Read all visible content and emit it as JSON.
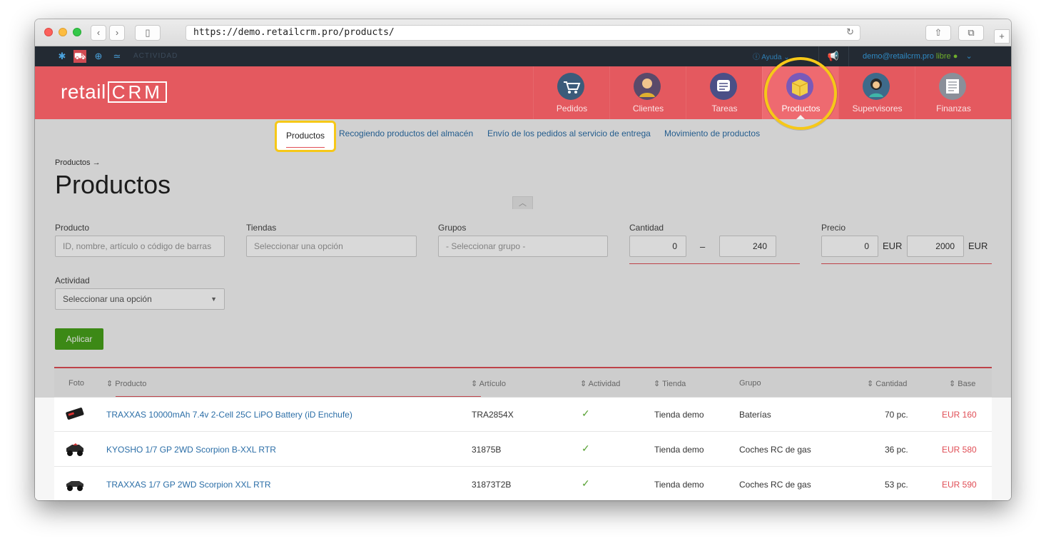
{
  "browser": {
    "url": "https://demo.retailcrm.pro/products/",
    "back_glyph": "‹",
    "forward_glyph": "›",
    "reload_glyph": "↻",
    "sidebar_glyph": "▯",
    "share_glyph": "⇧",
    "tabs_glyph": "⧉",
    "newtab_glyph": "+"
  },
  "topbar": {
    "actividad_label": "ACTIVIDAD",
    "help_label": "Ayuda",
    "user_email": "demo@retailcrm.pro",
    "user_status": "libre",
    "status_dot": "●",
    "chevron": "⌄"
  },
  "header": {
    "logo_text": "retail",
    "logo_crm": "CRM",
    "nav": [
      {
        "label": "Pedidos",
        "icon": "cart-icon",
        "color": "#3b5b7a"
      },
      {
        "label": "Clientes",
        "icon": "person-icon",
        "color": "#5a4a6a"
      },
      {
        "label": "Tareas",
        "icon": "list-icon",
        "color": "#4b4f86"
      },
      {
        "label": "Productos",
        "icon": "box-icon",
        "color": "#7a5ab8"
      },
      {
        "label": "Supervisores",
        "icon": "supervisor-icon",
        "color": "#3e6a8a"
      },
      {
        "label": "Finanzas",
        "icon": "ledger-icon",
        "color": "#8a8f99"
      }
    ]
  },
  "subnav": {
    "active": "Productos",
    "items": [
      "Recogiendo productos del almacén",
      "Envío de los pedidos al servicio de entrega",
      "Movimiento de productos"
    ]
  },
  "page": {
    "breadcrumb": "Productos →",
    "title": "Productos",
    "collapse_glyph": "︿"
  },
  "filters": {
    "producto": {
      "label": "Producto",
      "placeholder": "ID, nombre, artículo o código de barras"
    },
    "tiendas": {
      "label": "Tiendas",
      "placeholder": "Seleccionar una opción"
    },
    "grupos": {
      "label": "Grupos",
      "placeholder": "- Seleccionar grupo -"
    },
    "cantidad": {
      "label": "Cantidad",
      "min": "0",
      "max": "240",
      "dash": "–"
    },
    "precio": {
      "label": "Precio",
      "min": "0",
      "max": "2000",
      "currency": "EUR"
    },
    "actividad": {
      "label": "Actividad",
      "placeholder": "Seleccionar una opción",
      "caret": "▼"
    },
    "apply_label": "Aplicar"
  },
  "table": {
    "headers": {
      "foto": "Foto",
      "producto": "Producto",
      "articulo": "Artículo",
      "actividad": "Actividad",
      "tienda": "Tienda",
      "grupo": "Grupo",
      "cantidad": "Cantidad",
      "base": "Base"
    },
    "sort_glyph": "⇕",
    "check_glyph": "✓",
    "rows": [
      {
        "producto": "TRAXXAS 10000mAh 7.4v 2-Cell 25C LiPO Battery (iD Enchufe)",
        "articulo": "TRA2854X",
        "tienda": "Tienda demo",
        "grupo": "Baterías",
        "cantidad": "70 pc.",
        "base": "EUR 160"
      },
      {
        "producto": "KYOSHO 1/7 GP 2WD Scorpion B-XXL RTR",
        "articulo": "31875B",
        "tienda": "Tienda demo",
        "grupo": "Coches RC de gas",
        "cantidad": "36 pc.",
        "base": "EUR 580"
      },
      {
        "producto": "TRAXXAS 1/7 GP 2WD Scorpion XXL RTR",
        "articulo": "31873T2B",
        "tienda": "Tienda demo",
        "grupo": "Coches RC de gas",
        "cantidad": "53 pc.",
        "base": "EUR 590"
      }
    ]
  },
  "colors": {
    "header_red": "#e4595f",
    "link_blue": "#2b6ea7",
    "apply_green": "#47a11b",
    "highlight_yellow": "#f6c818",
    "price_red": "#e04e56"
  }
}
